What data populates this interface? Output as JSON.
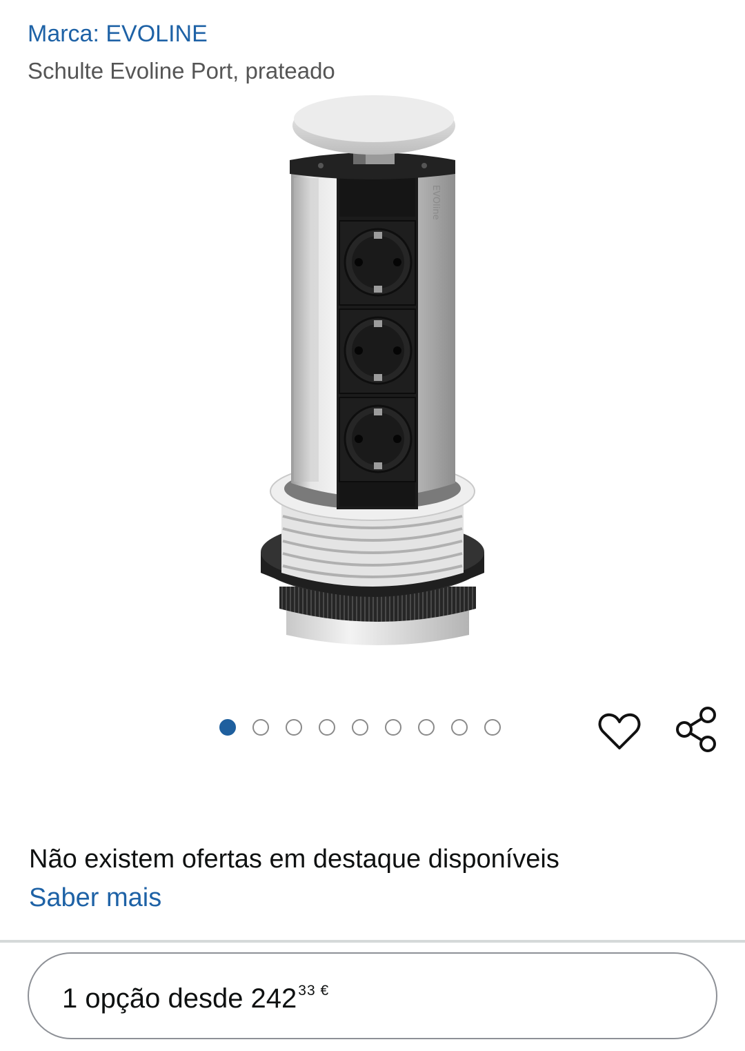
{
  "product": {
    "brand_label": "Marca: EVOLINE",
    "title": "Schulte Evoline Port, prateado",
    "image": {
      "alt": "Schulte Evoline Port pop-up socket tower",
      "printed_text": "EVOline"
    }
  },
  "gallery": {
    "count": 9,
    "active_index": 0
  },
  "actions": {
    "wishlist_icon": "heart-outline-icon",
    "share_icon": "share-icon"
  },
  "offers": {
    "message": "Não existem ofertas em destaque disponíveis",
    "learn_more": "Saber mais"
  },
  "option": {
    "text": "1 opção desde 242",
    "price_fraction": "33",
    "currency": "€"
  },
  "colors": {
    "link": "#1e62a6",
    "active_dot": "#1e5f9e",
    "text": "#0f1111"
  }
}
